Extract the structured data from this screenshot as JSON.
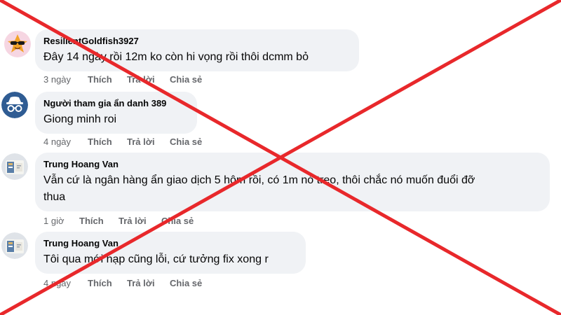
{
  "colors": {
    "bubble_bg": "#f0f2f5",
    "meta_text": "#65676b",
    "cross_stroke": "#e8282b",
    "avatar_blue": "#2f5c93"
  },
  "comments": [
    {
      "author": "ResilientGoldfish3927",
      "text": "Đây 14 ngày rồi 12m ko còn hi vọng rồi thôi dcmm bỏ",
      "time": "3 ngày",
      "like": "Thích",
      "reply": "Trả lời",
      "share": "Chia sẻ",
      "avatar_icon": "sunglasses-star-avatar"
    },
    {
      "author": "Người tham gia ẩn danh 389",
      "text": "Giong minh roi",
      "time": "4 ngày",
      "like": "Thích",
      "reply": "Trả lời",
      "share": "Chia sẻ",
      "avatar_icon": "anonymous-spy-avatar"
    },
    {
      "author": "Trung Hoang Van",
      "text_line1": "Vẫn cứ là ngân hàng ẩn giao dịch 5 hôm rồi, có 1m nó treo, thôi chắc nó muốn đuổi đỡ",
      "text_line2": "thua",
      "time": "1 giờ",
      "like": "Thích",
      "reply": "Trả lời",
      "share": "Chia sẻ",
      "avatar_icon": "photo-avatar"
    },
    {
      "author": "Trung Hoang Van",
      "text": "Tôi qua mới nạp cũng lỗi, cứ tưởng fix xong r",
      "time": "4 ngày",
      "like": "Thích",
      "reply": "Trả lời",
      "share": "Chia sẻ",
      "avatar_icon": "photo-avatar"
    }
  ]
}
